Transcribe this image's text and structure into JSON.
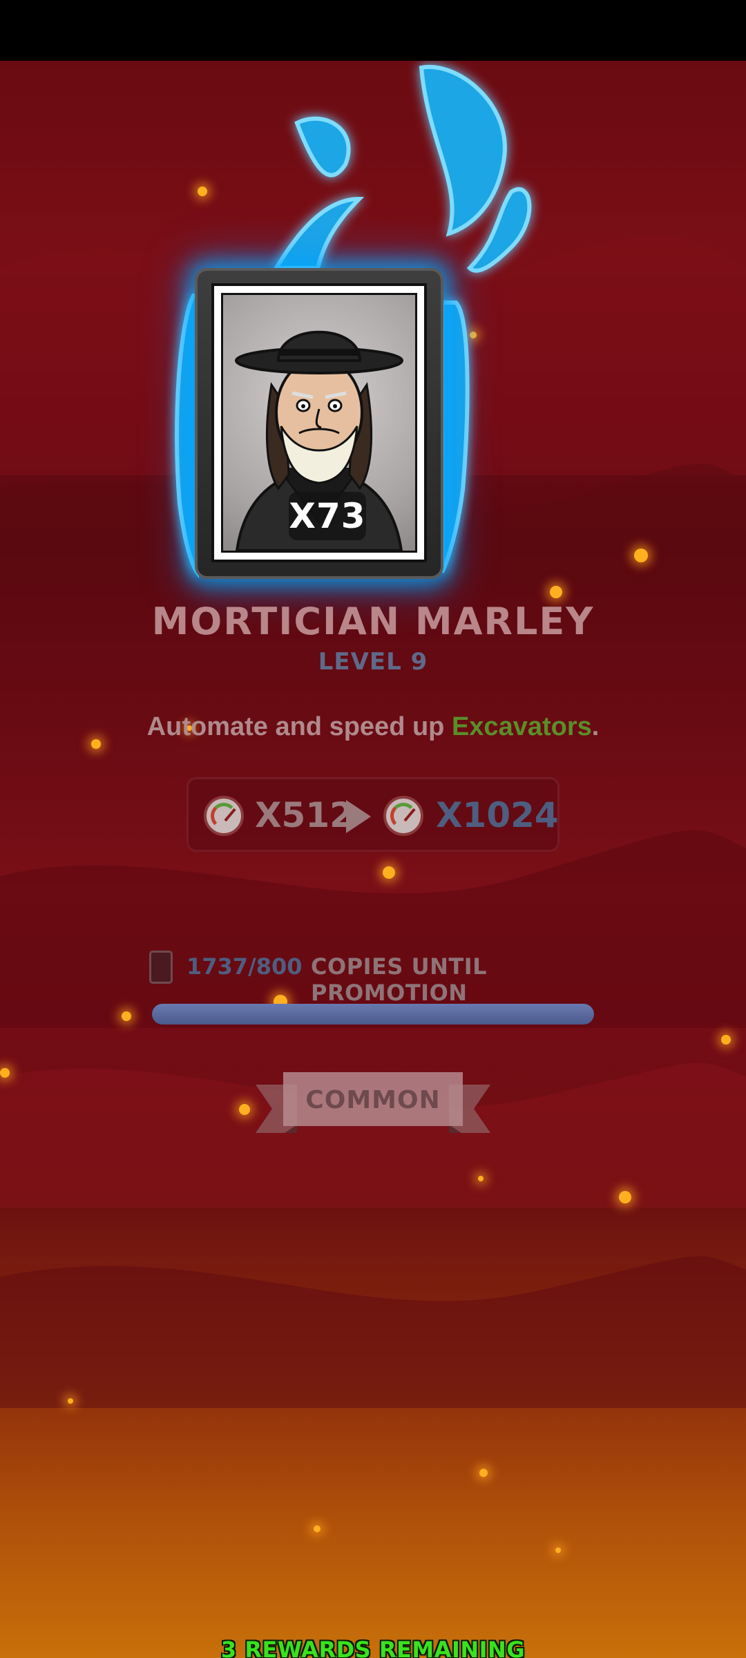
{
  "character": {
    "name": "MORTICIAN MARLEY",
    "level": "LEVEL 9",
    "count_badge": "X73"
  },
  "description": {
    "prefix": "Automate and speed up ",
    "highlight": "Excavators",
    "suffix": "."
  },
  "boost": {
    "current": "X512",
    "next": "X1024",
    "icon": "speedometer-icon"
  },
  "progress": {
    "copies": "1737/800",
    "label": "COPIES UNTIL PROMOTION",
    "fill_fraction": 1.0,
    "icon": "card-icon"
  },
  "rarity": {
    "label": "COMMON"
  },
  "footer": {
    "rewards_remaining": "3 REWARDS REMAINING"
  },
  "colors": {
    "highlight": "#5a8e2a",
    "rewards_text": "#39e21e",
    "aura": "#00aaff"
  }
}
